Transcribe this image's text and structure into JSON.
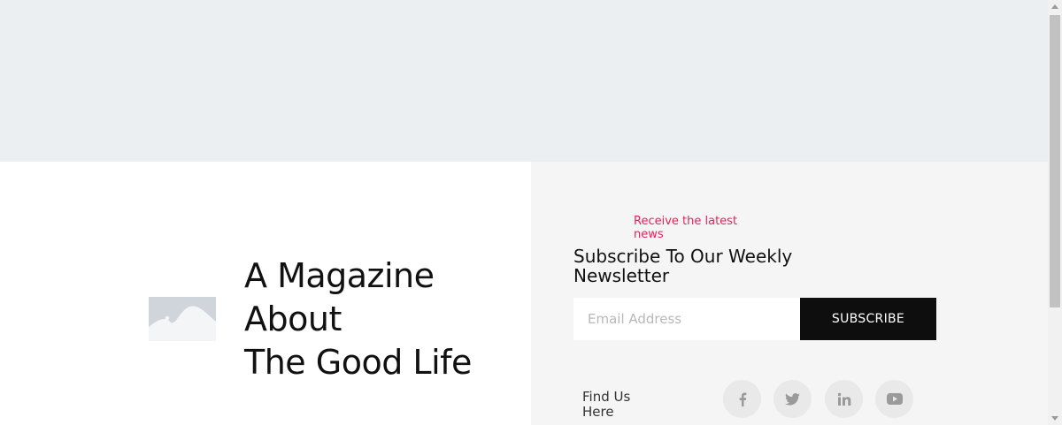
{
  "hero": {},
  "feature": {
    "image_icon": "image-placeholder-icon",
    "headline_lines": [
      "A Magazine",
      "About",
      "The Good Life"
    ]
  },
  "newsletter": {
    "eyebrow": "Receive the latest news",
    "title": "Subscribe To Our Weekly Newsletter",
    "email_placeholder": "Email Address",
    "email_value": "",
    "subscribe_label": "SUBSCRIBE"
  },
  "social": {
    "label": "Find Us Here",
    "links": [
      {
        "icon": "facebook-icon"
      },
      {
        "icon": "twitter-icon"
      },
      {
        "icon": "linkedin-icon"
      },
      {
        "icon": "youtube-icon"
      }
    ]
  },
  "colors": {
    "accent": "#e8205c",
    "button_bg": "#0e0e0e",
    "hero_bg": "#eceff2",
    "panel_bg": "#f5f5f5"
  }
}
